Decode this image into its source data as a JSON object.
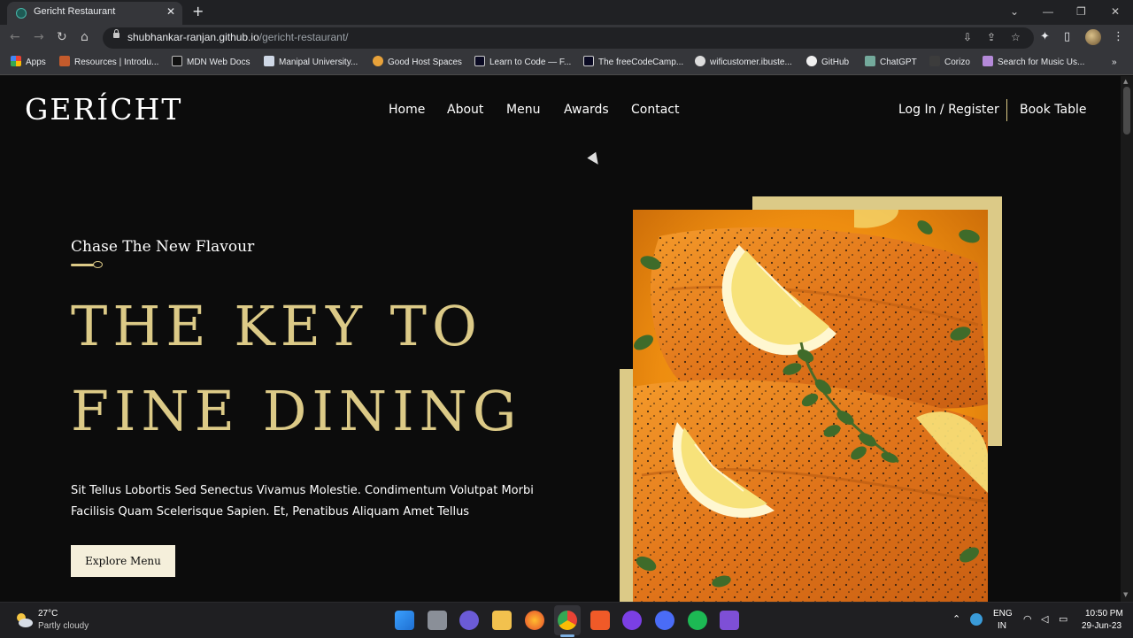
{
  "browser": {
    "tab_title": "Gericht Restaurant",
    "url_host": "shubhankar-ranjan.github.io",
    "url_path": "/gericht-restaurant/",
    "bookmarks": [
      "Apps",
      "Resources | Introdu...",
      "MDN Web Docs",
      "Manipal University...",
      "Good Host Spaces",
      "Learn to Code — F...",
      "The freeCodeCamp...",
      "wificustomer.ibuste...",
      "GitHub",
      "ChatGPT",
      "Corizo",
      "Search for Music Us..."
    ]
  },
  "site": {
    "logo": "GERÍCHT",
    "nav": [
      "Home",
      "About",
      "Menu",
      "Awards",
      "Contact"
    ],
    "login": "Log In / Register",
    "book": "Book Table",
    "subtitle": "Chase The New Flavour",
    "headline_1": "THE KEY TO",
    "headline_2": "FINE DINING",
    "description": "Sit Tellus Lobortis Sed Senectus Vivamus Molestie. Condimentum Volutpat Morbi Facilisis Quam Scelerisque Sapien. Et, Penatibus Aliquam Amet Tellus",
    "cta": "Explore Menu"
  },
  "taskbar": {
    "temperature": "27°C",
    "weather": "Partly cloudy",
    "lang_1": "ENG",
    "lang_2": "IN",
    "time": "10:50 PM",
    "date": "29-Jun-23"
  },
  "colors": {
    "gold": "#dcca87",
    "background": "#0c0c0c",
    "cta_bg": "#f5efdb"
  }
}
